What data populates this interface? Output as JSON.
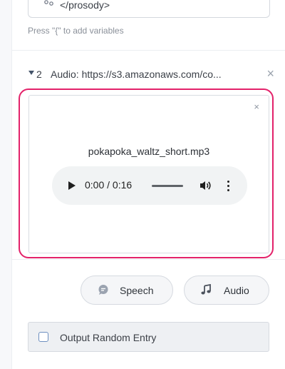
{
  "ssml_editor": {
    "icon": "variable-icon",
    "code_text": "</prosody>"
  },
  "hint": "Press \"{\" to add variables",
  "step": {
    "number": "2",
    "title": "Audio: https://s3.amazonaws.com/co...",
    "close_glyph": "×"
  },
  "audio_card": {
    "close_glyph": "×",
    "file_name": "pokapoka_waltz_short.mp3",
    "player": {
      "time_display": "0:00 / 0:16",
      "progress": 0.0,
      "icons": [
        "play-icon",
        "volume-icon",
        "more-options-icon"
      ]
    }
  },
  "add_buttons": [
    {
      "label": "Speech",
      "icon": "speech-bubble-icon"
    },
    {
      "label": "Audio",
      "icon": "music-note-icon"
    }
  ],
  "random_entry": {
    "label": "Output Random Entry",
    "checked": false
  },
  "colors": {
    "highlight": "#e3226a",
    "checkbox_border": "#6d8fbf",
    "button_bg": "#f5f6f8",
    "player_bg": "#f1f3f4"
  }
}
